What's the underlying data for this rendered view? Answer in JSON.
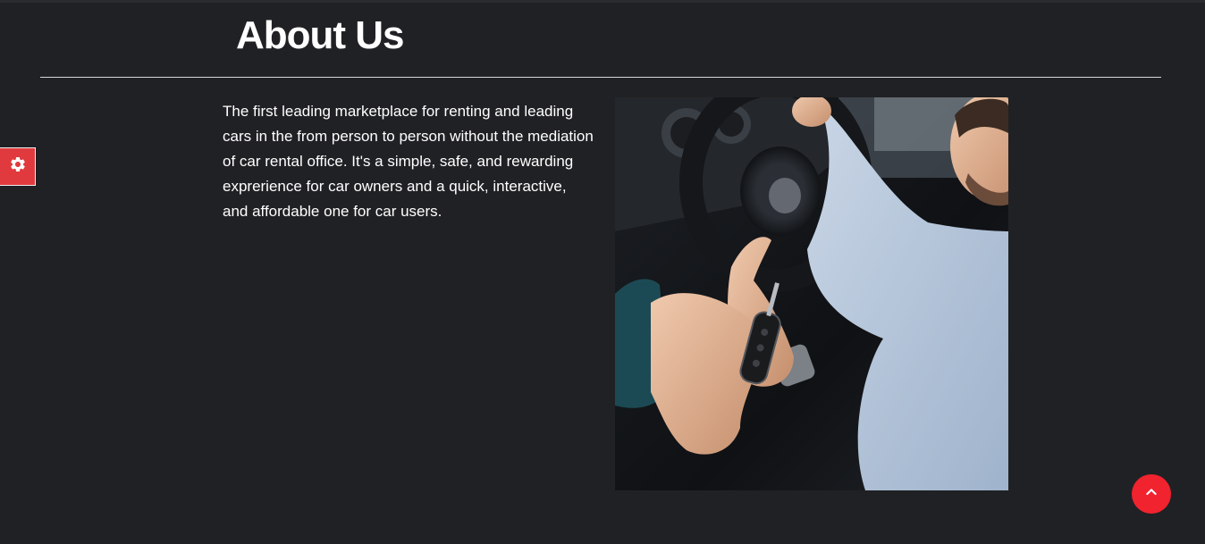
{
  "page": {
    "title": "About Us",
    "description": "The first leading marketplace for renting and leading cars in the from person to person without the mediation of car rental office. It's a simple, safe, and rewarding exprerience for car owners and a quick, interactive, and affordable one for car users."
  },
  "widgets": {
    "settings_icon": "gear-icon",
    "scroll_top_icon": "chevron-up-icon"
  },
  "colors": {
    "background": "#202124",
    "accent": "#f0232f",
    "settings_tab": "#e03a3e",
    "text": "#ffffff"
  }
}
